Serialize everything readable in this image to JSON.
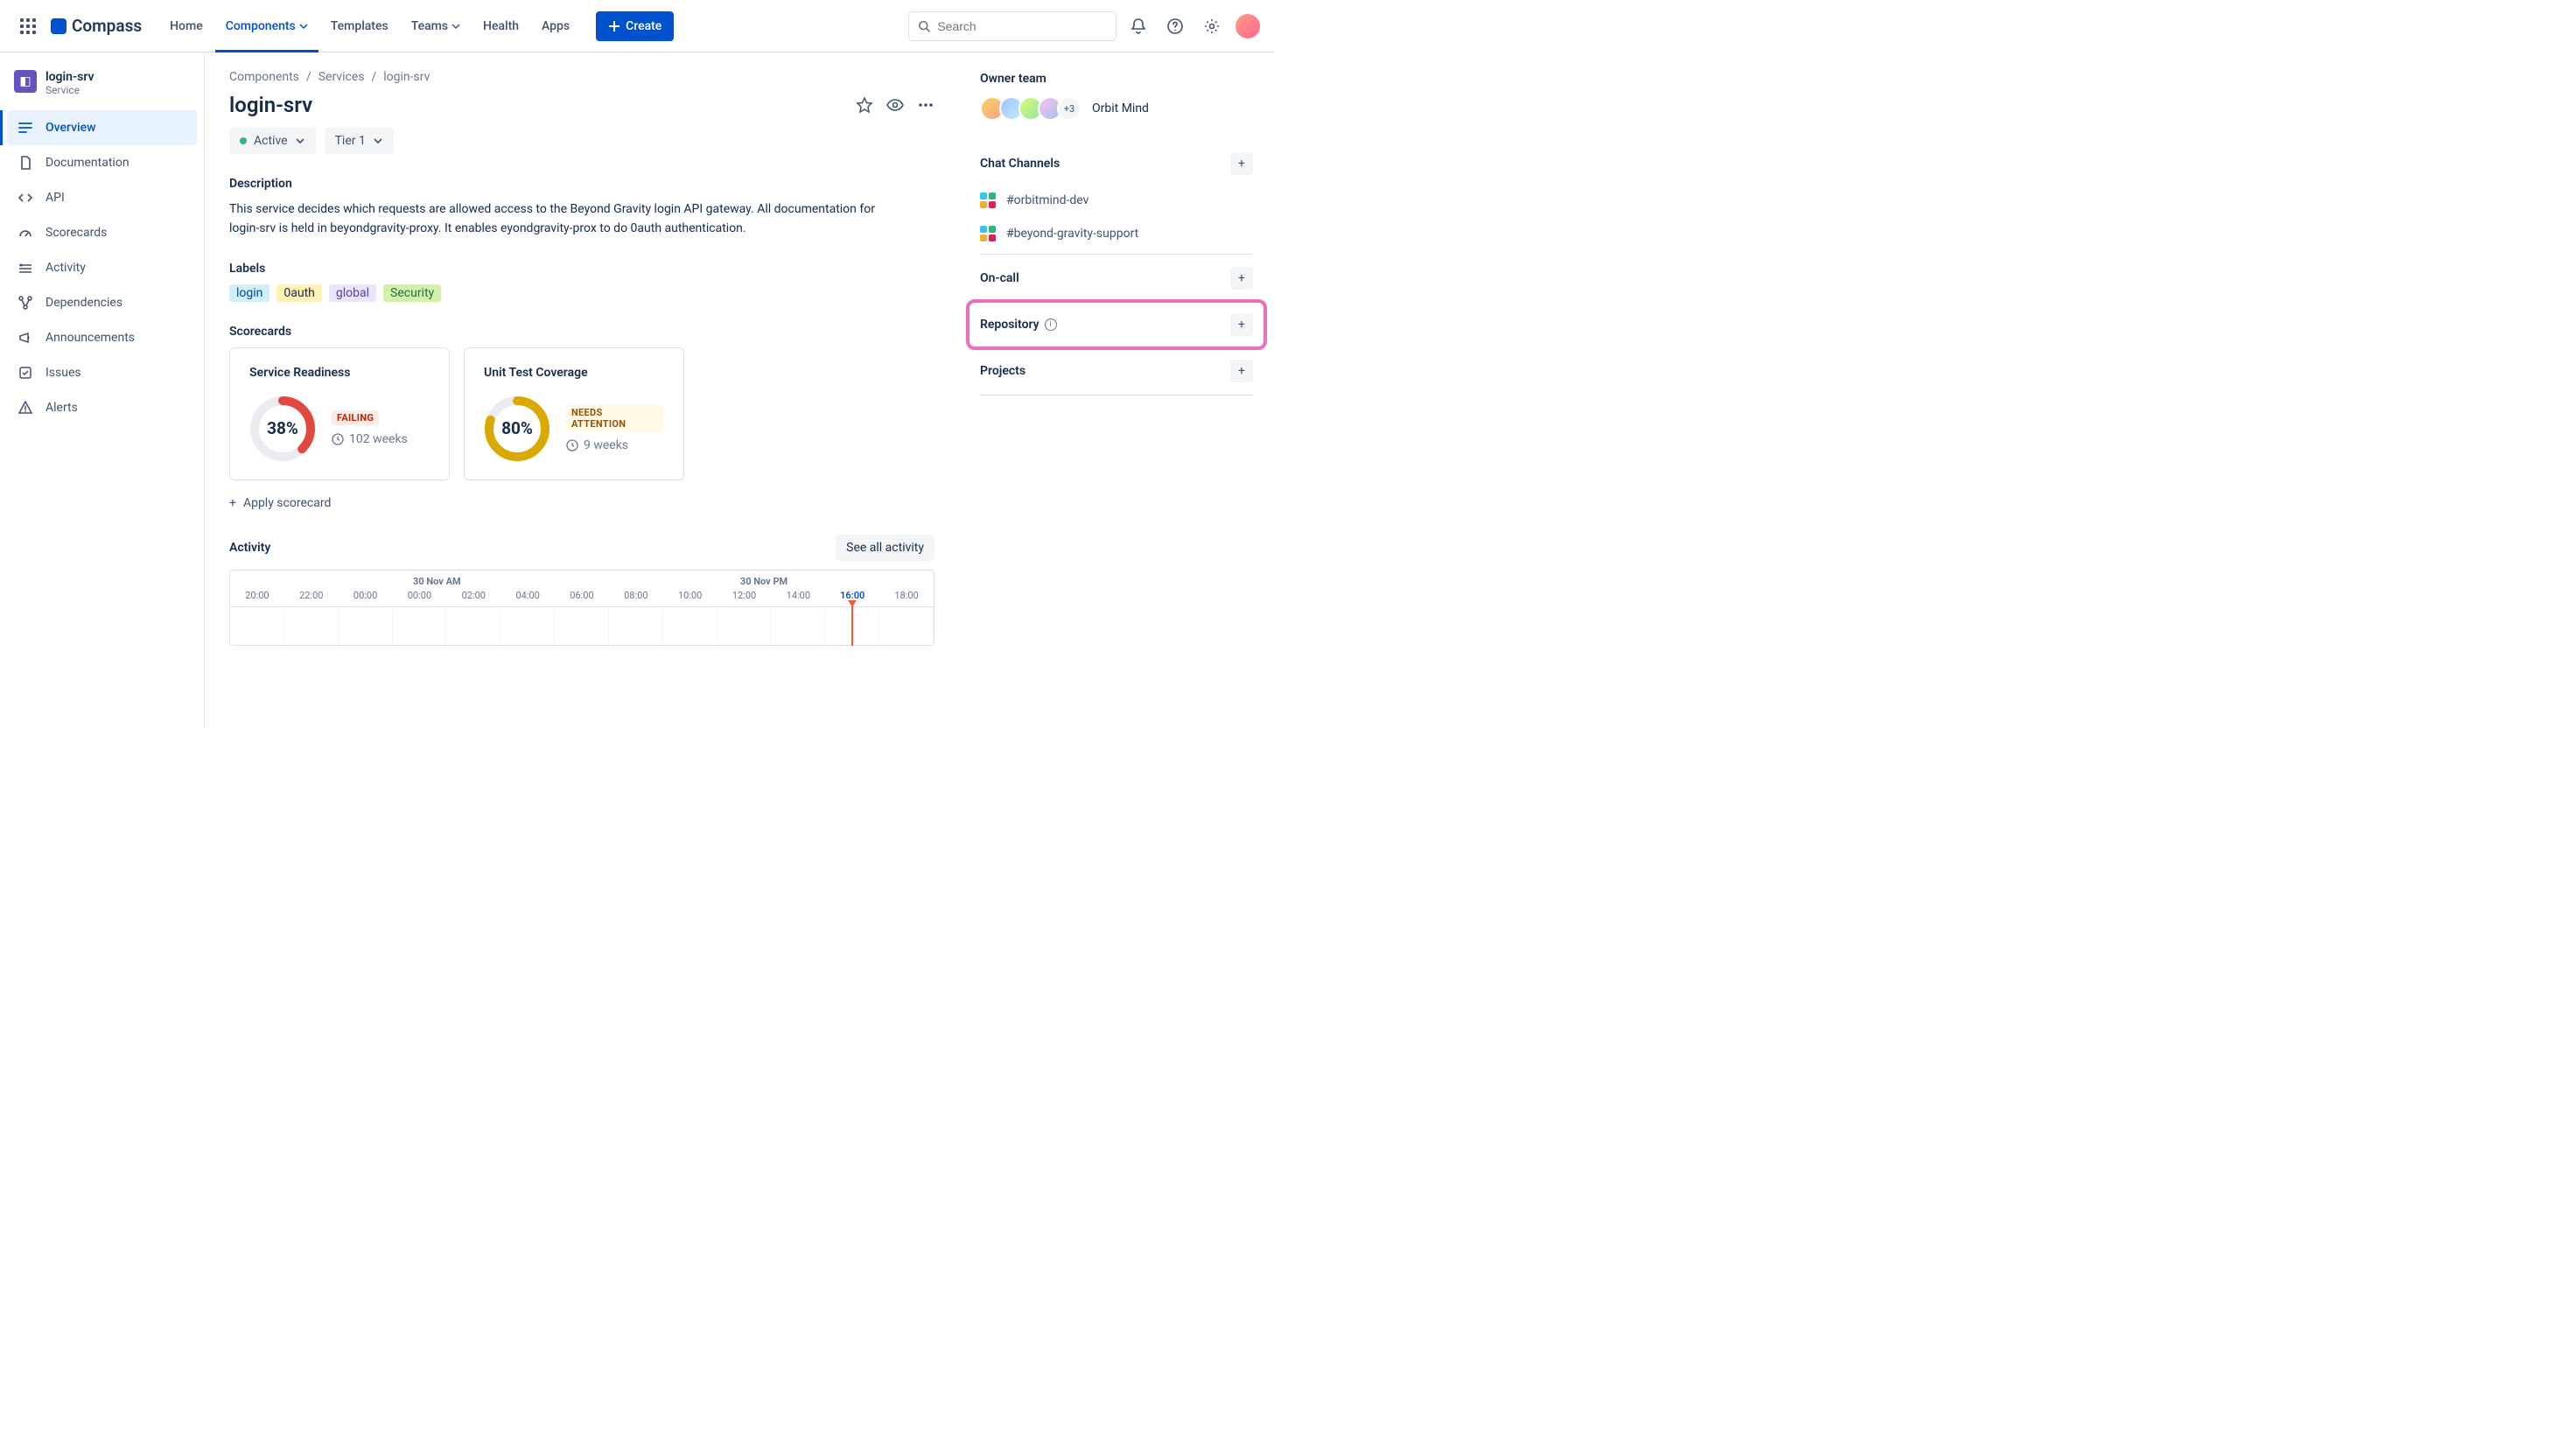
{
  "topnav": {
    "product": "Compass",
    "links": {
      "home": "Home",
      "components": "Components",
      "templates": "Templates",
      "teams": "Teams",
      "health": "Health",
      "apps": "Apps"
    },
    "create": "Create",
    "search_placeholder": "Search"
  },
  "sidebar": {
    "title": "login-srv",
    "subtitle": "Service",
    "items": {
      "overview": "Overview",
      "documentation": "Documentation",
      "api": "API",
      "scorecards": "Scorecards",
      "activity": "Activity",
      "dependencies": "Dependencies",
      "announcements": "Announcements",
      "issues": "Issues",
      "alerts": "Alerts"
    }
  },
  "breadcrumb": {
    "a": "Components",
    "b": "Services",
    "c": "login-srv"
  },
  "page": {
    "title": "login-srv",
    "status": "Active",
    "tier": "Tier 1",
    "description_h": "Description",
    "description": "This service decides which requests are allowed access to the Beyond Gravity login API gateway. All documentation for login-srv is held in beyondgravity-proxy. It enables eyondgravity-prox to do 0auth authentication.",
    "labels_h": "Labels",
    "labels": {
      "login": "login",
      "oauth": "0auth",
      "global": "global",
      "security": "Security"
    },
    "scorecards_h": "Scorecards",
    "sc1": {
      "title": "Service Readiness",
      "value": "38%",
      "status": "FAILING",
      "age": "102 weeks"
    },
    "sc2": {
      "title": "Unit Test Coverage",
      "value": "80%",
      "status": "NEEDS ATTENTION",
      "age": "9 weeks"
    },
    "apply_scorecard": "Apply scorecard",
    "activity_h": "Activity",
    "see_all": "See all activity",
    "timeline": {
      "label_am": "30 Nov AM",
      "label_pm": "30 Nov PM",
      "ticks": [
        "20:00",
        "22:00",
        "00:00",
        "00:00",
        "02:00",
        "04:00",
        "06:00",
        "08:00",
        "10:00",
        "12:00",
        "14:00",
        "16:00",
        "18:00"
      ],
      "current_index": 11
    }
  },
  "right": {
    "owner_h": "Owner team",
    "team_name": "Orbit Mind",
    "avatars_more": "+3",
    "chat_h": "Chat Channels",
    "chat1": "#orbitmind-dev",
    "chat2": "#beyond-gravity-support",
    "oncall_h": "On-call",
    "repo_h": "Repository",
    "projects_h": "Projects"
  }
}
